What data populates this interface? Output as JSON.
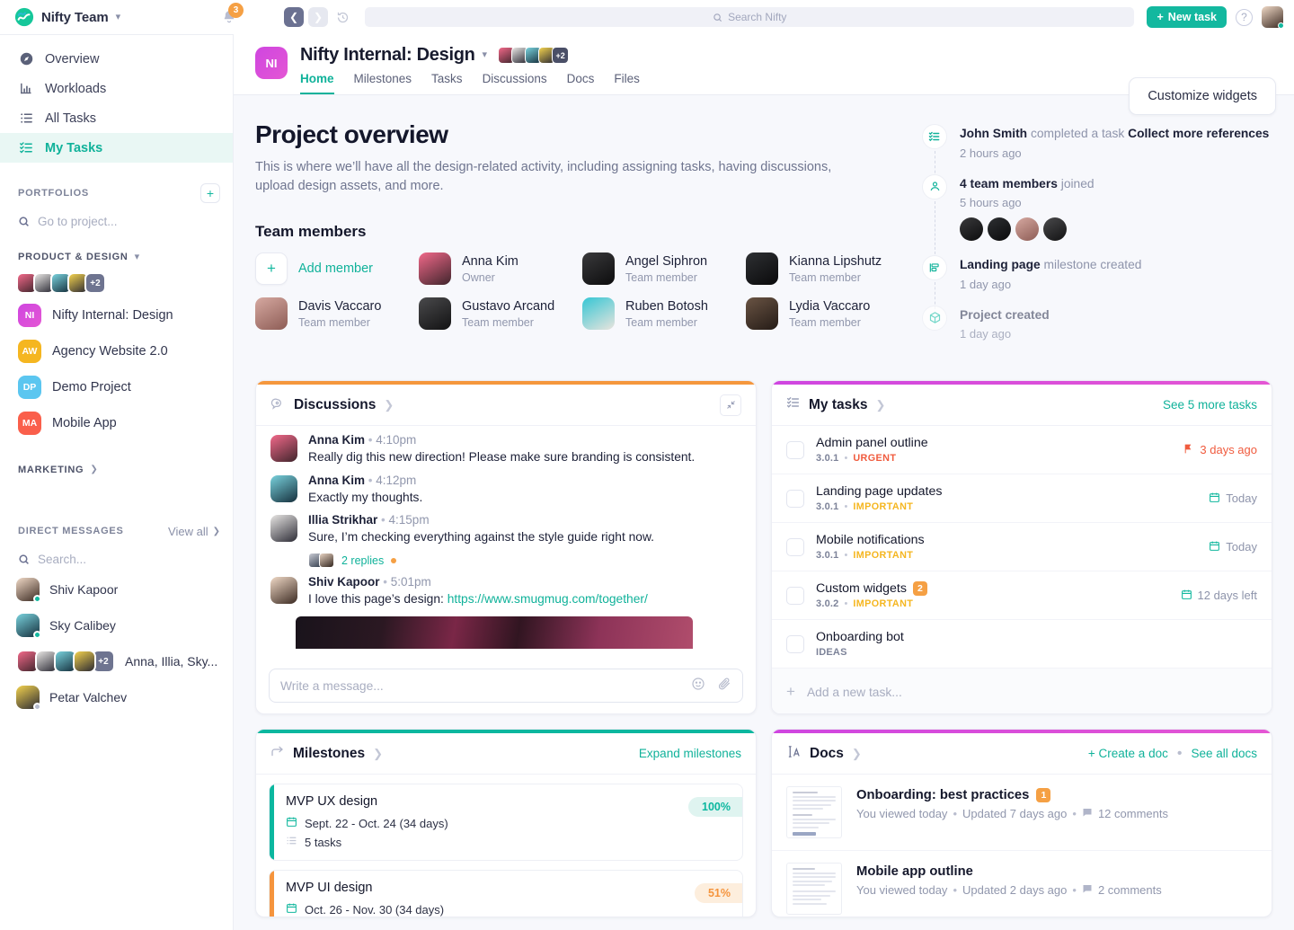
{
  "topbar": {
    "brand_name": "Nifty Team",
    "notification_count": "3",
    "search_placeholder": "Search Nifty",
    "new_task_label": "New task",
    "icons": {
      "logo": "nifty-logo-icon",
      "bell": "bell-icon",
      "back": "chevron-left-icon",
      "forward": "chevron-right-icon",
      "history": "history-icon",
      "search": "search-icon",
      "help": "help-icon"
    }
  },
  "sidebar": {
    "nav": [
      {
        "label": "Overview",
        "icon": "compass-icon",
        "active": false
      },
      {
        "label": "Workloads",
        "icon": "bar-chart-icon",
        "active": false
      },
      {
        "label": "All Tasks",
        "icon": "list-icon",
        "active": false
      },
      {
        "label": "My Tasks",
        "icon": "checklist-icon",
        "active": true
      }
    ],
    "portfolios_label": "PORTFOLIOS",
    "go_to_project_placeholder": "Go to project...",
    "product_design_label": "PRODUCT & DESIGN",
    "member_overflow": "+2",
    "projects": [
      {
        "initials": "NI",
        "name": "Nifty Internal: Design",
        "color": "#d646dd"
      },
      {
        "initials": "AW",
        "name": "Agency Website 2.0",
        "color": "#f5b620"
      },
      {
        "initials": "DP",
        "name": "Demo Project",
        "color": "#5bc6f0"
      },
      {
        "initials": "MA",
        "name": "Mobile App",
        "color": "#fa5f4b"
      }
    ],
    "marketing_label": "MARKETING",
    "direct_messages_label": "DIRECT MESSAGES",
    "view_all_label": "View all",
    "dm_search_placeholder": "Search...",
    "dms": [
      {
        "name": "Shiv Kapoor",
        "status": "#13b89f",
        "group": false
      },
      {
        "name": "Sky Calibey",
        "status": "#13b89f",
        "group": false
      },
      {
        "name": "Anna, Illia, Sky...",
        "status": "",
        "group": true,
        "overflow": "+2"
      },
      {
        "name": "Petar Valchev",
        "status": "#b7bccd",
        "group": false
      }
    ]
  },
  "project_header": {
    "initials": "NI",
    "title": "Nifty Internal: Design",
    "member_overflow": "+2",
    "tabs": [
      {
        "label": "Home",
        "selected": true
      },
      {
        "label": "Milestones",
        "selected": false
      },
      {
        "label": "Tasks",
        "selected": false
      },
      {
        "label": "Discussions",
        "selected": false
      },
      {
        "label": "Docs",
        "selected": false
      },
      {
        "label": "Files",
        "selected": false
      }
    ],
    "customize_widgets_label": "Customize widgets"
  },
  "overview": {
    "title": "Project overview",
    "description": "This is where we’ll have all the design-related activity, including assigning tasks, having discussions, upload design assets, and more.",
    "team_members_title": "Team members",
    "add_member_label": "Add member",
    "members": [
      {
        "name": "Anna Kim",
        "role": "Owner",
        "c1": "#f2698a",
        "c2": "#40252c"
      },
      {
        "name": "Angel Siphron",
        "role": "Team member",
        "c1": "#3a3a3c",
        "c2": "#0c0c0d"
      },
      {
        "name": "Kianna Lipshutz",
        "role": "Team member",
        "c1": "#2e3033",
        "c2": "#0a0a0b"
      },
      {
        "name": "Davis Vaccaro",
        "role": "Team member",
        "c1": "#d6a9a1",
        "c2": "#8d5c55"
      },
      {
        "name": "Gustavo Arcand",
        "role": "Team member",
        "c1": "#4a4a4c",
        "c2": "#121213"
      },
      {
        "name": "Ruben Botosh",
        "role": "Team member",
        "c1": "#35c6d4",
        "c2": "#e9e4dd"
      },
      {
        "name": "Lydia Vaccaro",
        "role": "Team member",
        "c1": "#6a5444",
        "c2": "#241b16"
      }
    ]
  },
  "activity": [
    {
      "actor": "John Smith",
      "action": "completed a task",
      "object": "Collect more references",
      "time": "2 hours ago",
      "icon": "checklist-icon",
      "avatars": []
    },
    {
      "actor": "4 team members",
      "action": "joined",
      "object": "",
      "time": "5 hours ago",
      "icon": "people-icon",
      "avatars": [
        "#3a3a3c",
        "#2e3033",
        "#d6a9a1",
        "#4a4a4c"
      ]
    },
    {
      "actor": "Landing page",
      "action": "milestone created",
      "object": "",
      "time": "1 day ago",
      "icon": "milestone-icon",
      "avatars": []
    },
    {
      "actor": "Project created",
      "action": "",
      "object": "",
      "time": "1 day ago",
      "icon": "cube-icon",
      "avatars": []
    }
  ],
  "discussions": {
    "title": "Discussions",
    "accent": "#f5973d",
    "collapse_icon": "collapse-icon",
    "header_icon": "discussion-icon",
    "messages": [
      {
        "author": "Anna Kim",
        "time": "4:10pm",
        "text": "Really dig this new direction! Please make sure branding is consistent.",
        "c1": "#f2698a",
        "c2": "#40252c"
      },
      {
        "author": "Anna Kim",
        "time": "4:12pm",
        "text": "Exactly my thoughts.",
        "c1": "#79d2dd",
        "c2": "#16303d"
      },
      {
        "author": "Illia Strikhar",
        "time": "4:15pm",
        "text": "Sure, I’m checking everything against the style guide right now.",
        "c1": "#e8e6e4",
        "c2": "#2d2c36",
        "replies_label": "2 replies"
      },
      {
        "author": "Shiv Kapoor",
        "time": "5:01pm",
        "text": "I love this page’s design: ",
        "link": "https://www.smugmug.com/together/",
        "c1": "#f0d9c6",
        "c2": "#3b2a22"
      }
    ],
    "composer_placeholder": "Write a message...",
    "composer_icons": [
      "emoji-icon",
      "attachment-icon"
    ]
  },
  "my_tasks": {
    "title": "My tasks",
    "accent": "#cf46e0",
    "header_icon": "checklist-icon",
    "see_more_label": "See 5 more tasks",
    "tasks": [
      {
        "name": "Admin panel outline",
        "version": "3.0.1",
        "priority": "URGENT",
        "priority_color": "#f05b3e",
        "due": "3 days ago",
        "due_icon": "flag-icon",
        "overdue": true,
        "count": ""
      },
      {
        "name": "Landing page updates",
        "version": "3.0.1",
        "priority": "IMPORTANT",
        "priority_color": "#f5b620",
        "due": "Today",
        "due_icon": "calendar-icon",
        "overdue": false,
        "count": ""
      },
      {
        "name": "Mobile notifications",
        "version": "3.0.1",
        "priority": "IMPORTANT",
        "priority_color": "#f5b620",
        "due": "Today",
        "due_icon": "calendar-icon",
        "overdue": false,
        "count": ""
      },
      {
        "name": "Custom widgets",
        "version": "3.0.2",
        "priority": "IMPORTANT",
        "priority_color": "#f5b620",
        "due": "12 days left",
        "due_icon": "calendar-icon",
        "overdue": false,
        "count": "2"
      },
      {
        "name": "Onboarding bot",
        "version": "IDEAS",
        "priority": "",
        "priority_color": "",
        "due": "",
        "due_icon": "",
        "overdue": false,
        "count": ""
      }
    ],
    "add_task_placeholder": "Add a new task..."
  },
  "milestones": {
    "title": "Milestones",
    "accent": "#0bb79f",
    "header_icon": "milestone-arrow-icon",
    "expand_label": "Expand milestones",
    "items": [
      {
        "name": "MVP UX design",
        "dates": "Sept. 22 - Oct. 24 (34 days)",
        "tasks": "5 tasks",
        "percent": "100%",
        "bar_color": "#0bb79f",
        "pct_bg": "#dff4f0",
        "pct_fg": "#0bb79f"
      },
      {
        "name": "MVP UI design",
        "dates": "Oct. 26 - Nov. 30 (34 days)",
        "tasks": "",
        "percent": "51%",
        "bar_color": "#f5943d",
        "pct_bg": "#fdeedd",
        "pct_fg": "#f5943d"
      }
    ]
  },
  "docs": {
    "title": "Docs",
    "accent": "#cf46e0",
    "header_icon": "doc-text-icon",
    "create_label": "+ Create a doc",
    "see_all_label": "See all docs",
    "items": [
      {
        "name": "Onboarding: best practices",
        "count": "1",
        "viewed": "You viewed today",
        "updated": "Updated 7 days ago",
        "comments": "12 comments"
      },
      {
        "name": "Mobile app outline",
        "count": "",
        "viewed": "You viewed today",
        "updated": "Updated 2 days ago",
        "comments": "2 comments"
      }
    ]
  }
}
